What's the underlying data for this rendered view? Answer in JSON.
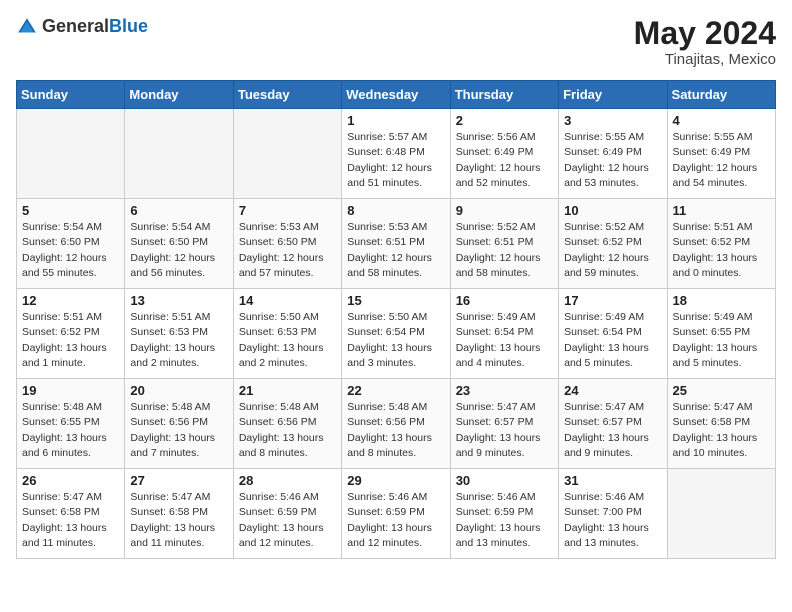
{
  "header": {
    "logo_general": "General",
    "logo_blue": "Blue",
    "month_year": "May 2024",
    "location": "Tinajitas, Mexico"
  },
  "days_of_week": [
    "Sunday",
    "Monday",
    "Tuesday",
    "Wednesday",
    "Thursday",
    "Friday",
    "Saturday"
  ],
  "weeks": [
    [
      {
        "day": "",
        "info": ""
      },
      {
        "day": "",
        "info": ""
      },
      {
        "day": "",
        "info": ""
      },
      {
        "day": "1",
        "info": "Sunrise: 5:57 AM\nSunset: 6:48 PM\nDaylight: 12 hours\nand 51 minutes."
      },
      {
        "day": "2",
        "info": "Sunrise: 5:56 AM\nSunset: 6:49 PM\nDaylight: 12 hours\nand 52 minutes."
      },
      {
        "day": "3",
        "info": "Sunrise: 5:55 AM\nSunset: 6:49 PM\nDaylight: 12 hours\nand 53 minutes."
      },
      {
        "day": "4",
        "info": "Sunrise: 5:55 AM\nSunset: 6:49 PM\nDaylight: 12 hours\nand 54 minutes."
      }
    ],
    [
      {
        "day": "5",
        "info": "Sunrise: 5:54 AM\nSunset: 6:50 PM\nDaylight: 12 hours\nand 55 minutes."
      },
      {
        "day": "6",
        "info": "Sunrise: 5:54 AM\nSunset: 6:50 PM\nDaylight: 12 hours\nand 56 minutes."
      },
      {
        "day": "7",
        "info": "Sunrise: 5:53 AM\nSunset: 6:50 PM\nDaylight: 12 hours\nand 57 minutes."
      },
      {
        "day": "8",
        "info": "Sunrise: 5:53 AM\nSunset: 6:51 PM\nDaylight: 12 hours\nand 58 minutes."
      },
      {
        "day": "9",
        "info": "Sunrise: 5:52 AM\nSunset: 6:51 PM\nDaylight: 12 hours\nand 58 minutes."
      },
      {
        "day": "10",
        "info": "Sunrise: 5:52 AM\nSunset: 6:52 PM\nDaylight: 12 hours\nand 59 minutes."
      },
      {
        "day": "11",
        "info": "Sunrise: 5:51 AM\nSunset: 6:52 PM\nDaylight: 13 hours\nand 0 minutes."
      }
    ],
    [
      {
        "day": "12",
        "info": "Sunrise: 5:51 AM\nSunset: 6:52 PM\nDaylight: 13 hours\nand 1 minute."
      },
      {
        "day": "13",
        "info": "Sunrise: 5:51 AM\nSunset: 6:53 PM\nDaylight: 13 hours\nand 2 minutes."
      },
      {
        "day": "14",
        "info": "Sunrise: 5:50 AM\nSunset: 6:53 PM\nDaylight: 13 hours\nand 2 minutes."
      },
      {
        "day": "15",
        "info": "Sunrise: 5:50 AM\nSunset: 6:54 PM\nDaylight: 13 hours\nand 3 minutes."
      },
      {
        "day": "16",
        "info": "Sunrise: 5:49 AM\nSunset: 6:54 PM\nDaylight: 13 hours\nand 4 minutes."
      },
      {
        "day": "17",
        "info": "Sunrise: 5:49 AM\nSunset: 6:54 PM\nDaylight: 13 hours\nand 5 minutes."
      },
      {
        "day": "18",
        "info": "Sunrise: 5:49 AM\nSunset: 6:55 PM\nDaylight: 13 hours\nand 5 minutes."
      }
    ],
    [
      {
        "day": "19",
        "info": "Sunrise: 5:48 AM\nSunset: 6:55 PM\nDaylight: 13 hours\nand 6 minutes."
      },
      {
        "day": "20",
        "info": "Sunrise: 5:48 AM\nSunset: 6:56 PM\nDaylight: 13 hours\nand 7 minutes."
      },
      {
        "day": "21",
        "info": "Sunrise: 5:48 AM\nSunset: 6:56 PM\nDaylight: 13 hours\nand 8 minutes."
      },
      {
        "day": "22",
        "info": "Sunrise: 5:48 AM\nSunset: 6:56 PM\nDaylight: 13 hours\nand 8 minutes."
      },
      {
        "day": "23",
        "info": "Sunrise: 5:47 AM\nSunset: 6:57 PM\nDaylight: 13 hours\nand 9 minutes."
      },
      {
        "day": "24",
        "info": "Sunrise: 5:47 AM\nSunset: 6:57 PM\nDaylight: 13 hours\nand 9 minutes."
      },
      {
        "day": "25",
        "info": "Sunrise: 5:47 AM\nSunset: 6:58 PM\nDaylight: 13 hours\nand 10 minutes."
      }
    ],
    [
      {
        "day": "26",
        "info": "Sunrise: 5:47 AM\nSunset: 6:58 PM\nDaylight: 13 hours\nand 11 minutes."
      },
      {
        "day": "27",
        "info": "Sunrise: 5:47 AM\nSunset: 6:58 PM\nDaylight: 13 hours\nand 11 minutes."
      },
      {
        "day": "28",
        "info": "Sunrise: 5:46 AM\nSunset: 6:59 PM\nDaylight: 13 hours\nand 12 minutes."
      },
      {
        "day": "29",
        "info": "Sunrise: 5:46 AM\nSunset: 6:59 PM\nDaylight: 13 hours\nand 12 minutes."
      },
      {
        "day": "30",
        "info": "Sunrise: 5:46 AM\nSunset: 6:59 PM\nDaylight: 13 hours\nand 13 minutes."
      },
      {
        "day": "31",
        "info": "Sunrise: 5:46 AM\nSunset: 7:00 PM\nDaylight: 13 hours\nand 13 minutes."
      },
      {
        "day": "",
        "info": ""
      }
    ]
  ]
}
